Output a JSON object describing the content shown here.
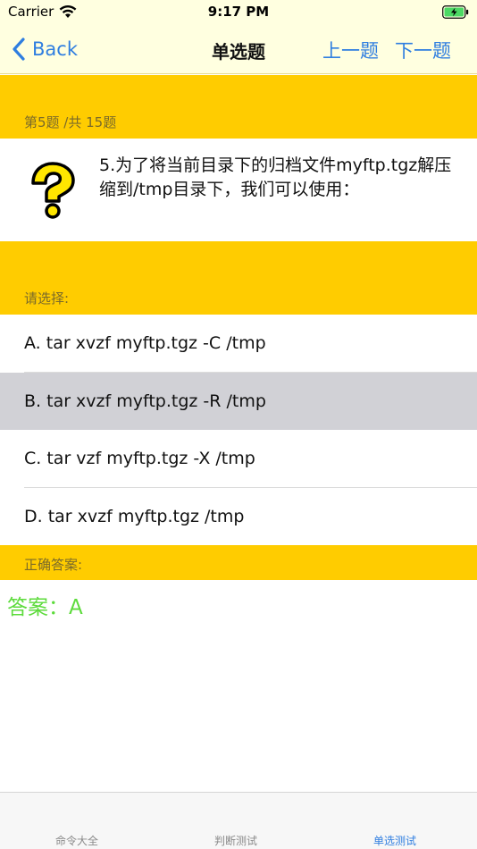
{
  "status_bar": {
    "carrier": "Carrier",
    "time": "9:17 PM"
  },
  "nav": {
    "back_label": "Back",
    "title": "单选题",
    "prev_label": "上一题",
    "next_label": "下一题"
  },
  "progress": "第5题 /共 15题",
  "question": {
    "icon": "question-mark-icon",
    "text": "5.为了将当前目录下的归档文件myftp.tgz解压缩到/tmp目录下，我们可以使用："
  },
  "choose_label": "请选择:",
  "options": [
    {
      "label": "A. tar xvzf myftp.tgz -C /tmp",
      "selected": false
    },
    {
      "label": "B. tar xvzf myftp.tgz -R /tmp",
      "selected": true
    },
    {
      "label": "C. tar vzf myftp.tgz -X /tmp",
      "selected": false
    },
    {
      "label": "D. tar xvzf myftp.tgz /tmp",
      "selected": false
    }
  ],
  "answer_label": "正确答案:",
  "answer_text": "答案：A",
  "tabs": [
    {
      "label": "命令大全",
      "active": false
    },
    {
      "label": "判断测试",
      "active": false
    },
    {
      "label": "单选测试",
      "active": true
    }
  ],
  "colors": {
    "accent": "#2f7ee0",
    "section": "#ffcc00",
    "nav_bg": "#ffffe0",
    "answer": "#5ddb3c",
    "selected_option": "#d1d1d6"
  }
}
